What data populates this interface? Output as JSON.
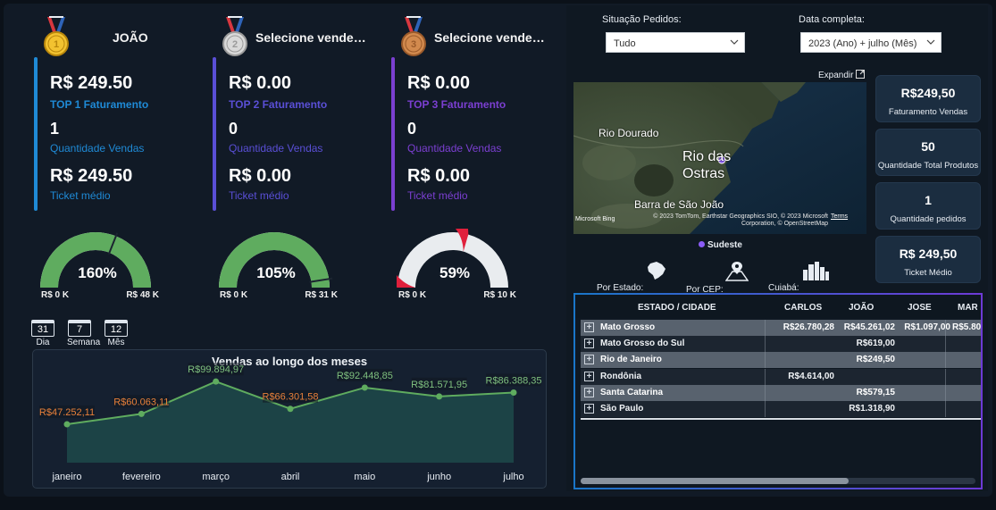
{
  "sellers": [
    {
      "rank": 1,
      "name": "JOÃO",
      "faturamento": "R$ 249.50",
      "top_label": "TOP 1 Faturamento",
      "quantidade": "1",
      "quantidade_label": "Quantidade Vendas",
      "ticket": "R$ 249.50",
      "ticket_label": "Ticket médio",
      "gauge_pct": "160%",
      "gauge_fraction": 1.0,
      "gauge_target_fraction": 0.62,
      "gauge_min": "R$ 0 K",
      "gauge_max": "R$ 48 K",
      "accent": "#1f8ad6",
      "gauge_color": "#5fac5f"
    },
    {
      "rank": 2,
      "name": "Selecione vendedor(a)",
      "faturamento": "R$ 0.00",
      "top_label": "TOP 2 Faturamento",
      "quantidade": "0",
      "quantidade_label": "Quantidade Vendas",
      "ticket": "R$ 0.00",
      "ticket_label": "Ticket médio",
      "gauge_pct": "105%",
      "gauge_fraction": 1.0,
      "gauge_target_fraction": 0.95,
      "gauge_min": "R$ 0 K",
      "gauge_max": "R$ 31 K",
      "accent": "#5a4fd6",
      "gauge_color": "#5fac5f"
    },
    {
      "rank": 3,
      "name": "Selecione vendedor(a)",
      "faturamento": "R$ 0.00",
      "top_label": "TOP 3 Faturamento",
      "quantidade": "0",
      "quantidade_label": "Quantidade Vendas",
      "ticket": "R$ 0.00",
      "ticket_label": "Ticket médio",
      "gauge_pct": "59%",
      "gauge_fraction": 0.59,
      "gauge_target_fraction": null,
      "gauge_min": "R$ 0 K",
      "gauge_max": "R$ 10 K",
      "accent": "#7b3fd1",
      "gauge_color": "#e0203c"
    }
  ],
  "period_buttons": [
    {
      "icon": "31",
      "label": "Dia"
    },
    {
      "icon": "7",
      "label": "Semana"
    },
    {
      "icon": "12",
      "label": "Mês"
    }
  ],
  "chart_data": {
    "type": "area",
    "title": "Vendas ao longo dos meses",
    "categories": [
      "janeiro",
      "fevereiro",
      "março",
      "abril",
      "maio",
      "junho",
      "julho"
    ],
    "values": [
      47252.11,
      60063.11,
      99894.97,
      66301.58,
      92448.85,
      81571.95,
      86388.35
    ],
    "data_labels": [
      "R$47.252,11",
      "R$60.063,11",
      "R$99.894,97",
      "R$66.301,58",
      "R$92.448,85",
      "R$81.571,95",
      "R$86.388,35"
    ],
    "label_colors": [
      "#e8803a",
      "#e8803a",
      "#7fc07f",
      "#e8803a",
      "#7fc07f",
      "#7fc07f",
      "#7fc07f"
    ],
    "ylim": [
      0,
      110000
    ],
    "grid": false,
    "line_color": "#5fac5f"
  },
  "filters": {
    "situacao_label": "Situação Pedidos:",
    "situacao_value": "Tudo",
    "data_label": "Data completa:",
    "data_value": "2023 (Ano) + julho (Mês)"
  },
  "map": {
    "expand_label": "Expandir",
    "places": [
      "Rio Dourado",
      "Rio das Ostras",
      "Barra de São João"
    ],
    "attribution": "© 2023 TomTom, Earthstar Geographics SIO, © 2023 Microsoft Corporation, © OpenStreetMap",
    "terms": "Terms",
    "bing": "Microsoft Bing",
    "legend": "Sudeste"
  },
  "kpis": [
    {
      "value": "R$249,50",
      "label": "Faturamento Vendas"
    },
    {
      "value": "50",
      "label": "Quantidade Total Produtos"
    },
    {
      "value": "1",
      "label": "Quantidade pedidos"
    },
    {
      "value": "R$ 249,50",
      "label": "Ticket Médio"
    }
  ],
  "map_nav": [
    {
      "label": "Por Estado:",
      "icon": "brazil-map-icon"
    },
    {
      "label": "Por CEP:",
      "icon": "map-pin-icon"
    },
    {
      "label": "Cuiabá:",
      "icon": "city-icon"
    }
  ],
  "table": {
    "headers": [
      "ESTADO / CIDADE",
      "CARLOS",
      "JOÃO",
      "JOSE",
      "MARIA"
    ],
    "rows": [
      {
        "name": "Mato Grosso",
        "values": [
          "R$26.780,28",
          "R$45.261,02",
          "R$1.097,00",
          "R$5.80"
        ]
      },
      {
        "name": "Mato Grosso do Sul",
        "values": [
          "",
          "R$619,00",
          "",
          ""
        ]
      },
      {
        "name": "Rio de Janeiro",
        "values": [
          "",
          "R$249,50",
          "",
          ""
        ]
      },
      {
        "name": "Rondônia",
        "values": [
          "R$4.614,00",
          "",
          "",
          ""
        ]
      },
      {
        "name": "Santa Catarina",
        "values": [
          "",
          "R$579,15",
          "",
          ""
        ]
      },
      {
        "name": "São Paulo",
        "values": [
          "",
          "R$1.318,90",
          "",
          ""
        ]
      }
    ]
  }
}
